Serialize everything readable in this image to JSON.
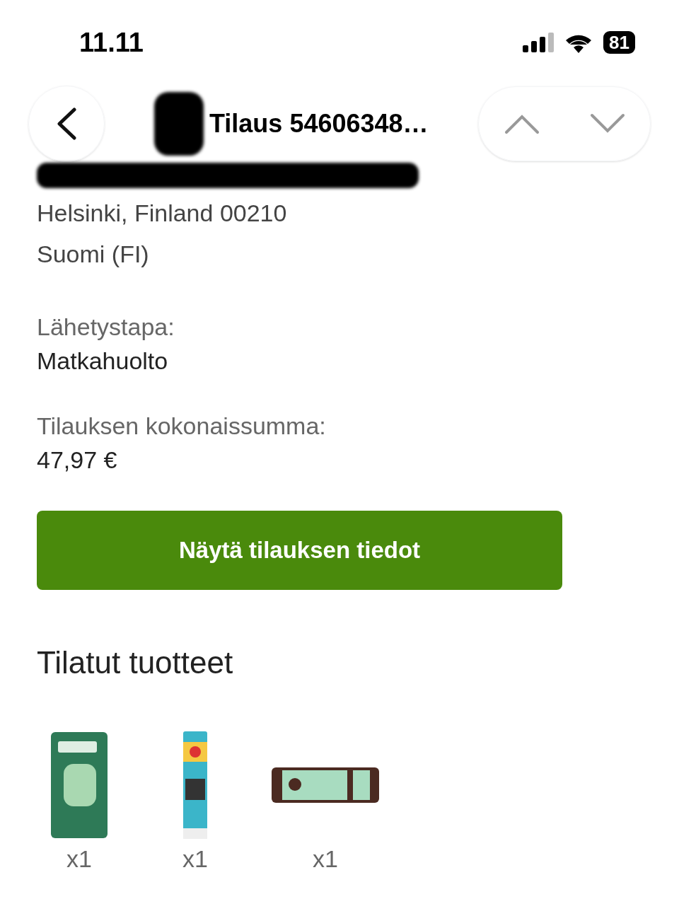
{
  "status_bar": {
    "time": "11.11",
    "battery": "81"
  },
  "nav": {
    "title": "Tilaus 54606348…"
  },
  "address": [
    "Helsinki, Finland 00210",
    "Suomi (FI)"
  ],
  "shipping": {
    "label": "Lähetystapa:",
    "value": "Matkahuolto"
  },
  "total": {
    "label": "Tilauksen kokonaissumma:",
    "value": "47,97 €"
  },
  "details_button": "Näytä tilauksen tiedot",
  "products_heading": "Tilatut tuotteet",
  "products": [
    {
      "kind": "picture",
      "quantity": "x1"
    },
    {
      "kind": "picture",
      "quantity": "x1"
    },
    {
      "kind": "picture",
      "quantity": "x1"
    }
  ]
}
